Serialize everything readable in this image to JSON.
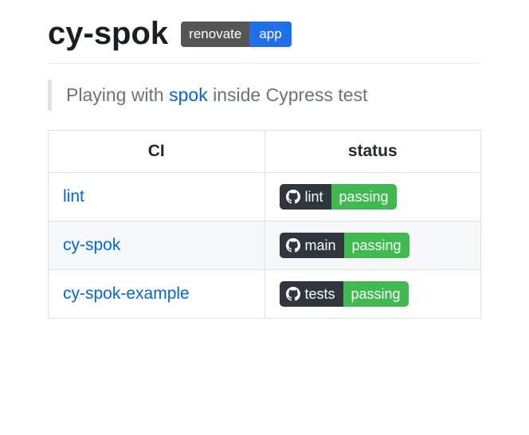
{
  "header": {
    "title": "cy-spok",
    "badge": {
      "left": "renovate",
      "right": "app"
    }
  },
  "blockquote": {
    "before": "Playing with ",
    "link": "spok",
    "after": " inside Cypress test"
  },
  "table": {
    "headers": {
      "ci": "CI",
      "status": "status"
    },
    "rows": [
      {
        "ci": "lint",
        "badge": {
          "label": "lint",
          "status": "passing"
        }
      },
      {
        "ci": "cy-spok",
        "badge": {
          "label": "main",
          "status": "passing"
        }
      },
      {
        "ci": "cy-spok-example",
        "badge": {
          "label": "tests",
          "status": "passing"
        }
      }
    ]
  }
}
